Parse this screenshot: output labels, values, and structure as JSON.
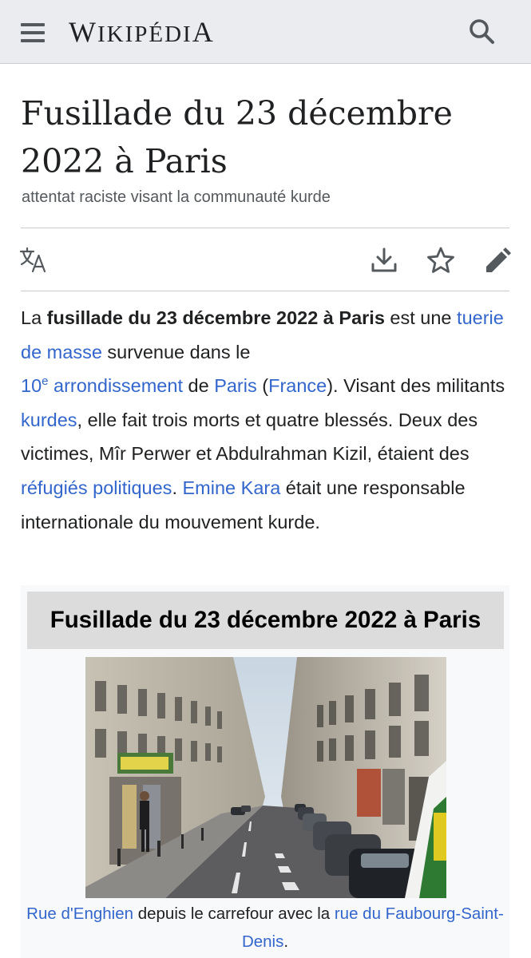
{
  "header": {
    "menu_icon": "hamburger-menu-icon",
    "logo_initial": "W",
    "logo_rest": "IKIPÉDI",
    "logo_final": "A",
    "search_icon": "magnifier-icon"
  },
  "article": {
    "title": "Fusillade du 23 décembre 2022 à Paris",
    "description": "attentat raciste visant la communauté kurde"
  },
  "actions": {
    "language_icon": "translate-icon",
    "download_icon": "download-icon",
    "watch_icon": "star-icon",
    "edit_icon": "pencil-icon"
  },
  "lead": {
    "t1": "La ",
    "b1": "fusillade du 23 décembre 2022 à Paris",
    "t2": " est une ",
    "l1": "tuerie de masse",
    "t3": " survenue dans le ",
    "l2a": "10",
    "l2sup": "e",
    "l2b": " arrondissement",
    "t4": " de ",
    "l3": "Paris",
    "t5": " (",
    "l4": "France",
    "t6": "). Visant des militants ",
    "l5": "kurdes",
    "t7": ", elle fait trois morts et quatre blessés. Deux des victimes, Mîr Perwer et Abdulrahman Kizil, étaient des ",
    "l6": "réfugiés politiques",
    "t8": ". ",
    "l7": "Emine Kara",
    "t9": " était une responsable internationale du mouvement kurde."
  },
  "infobox": {
    "title": "Fusillade du 23 décembre 2022 à Paris",
    "caption_link1": "Rue d'Enghien",
    "caption_text1": " depuis le carrefour avec la ",
    "caption_link2": "rue du Faubourg-Saint-Denis",
    "caption_text2": "."
  },
  "colors": {
    "link": "#3366cc",
    "header_bg": "#eaecf0",
    "infobox_bg": "#f8f9fa",
    "infobox_title_bg": "#dcdcdc"
  }
}
